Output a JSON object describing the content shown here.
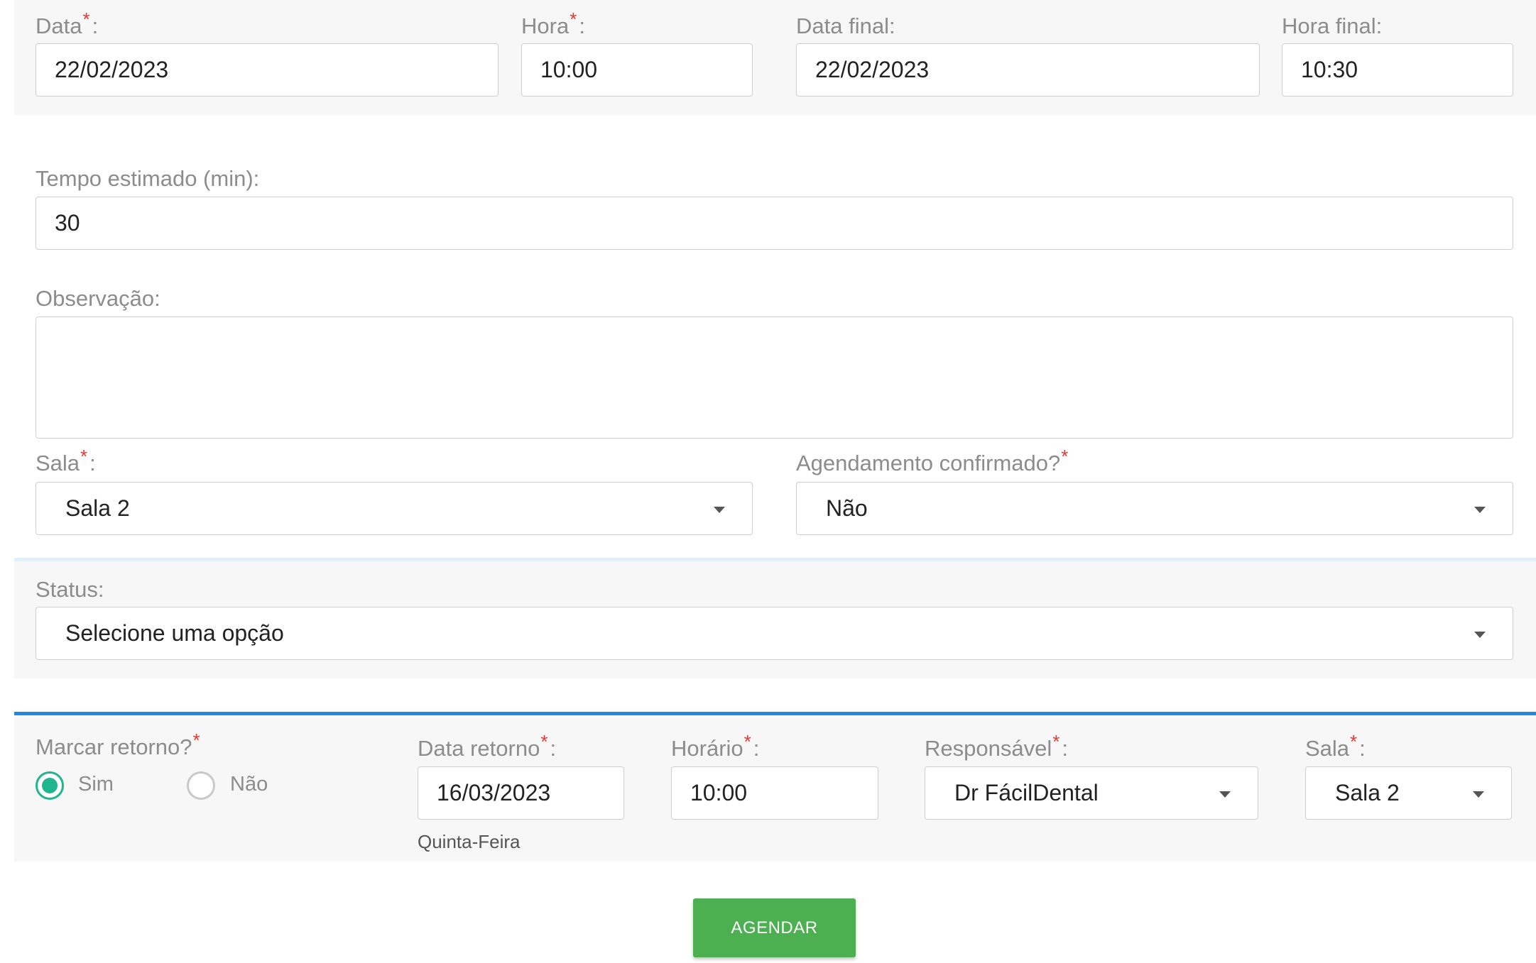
{
  "top": {
    "data": {
      "label": "Data",
      "value": "22/02/2023"
    },
    "hora": {
      "label": "Hora",
      "value": "10:00"
    },
    "data_final": {
      "label": "Data final:",
      "value": "22/02/2023"
    },
    "hora_final": {
      "label": "Hora final:",
      "value": "10:30"
    }
  },
  "tempo": {
    "label": "Tempo estimado (min):",
    "value": "30"
  },
  "observacao": {
    "label": "Observação:",
    "value": ""
  },
  "sala": {
    "label": "Sala",
    "value": "Sala 2"
  },
  "confirmado": {
    "label": "Agendamento confirmado?",
    "value": "Não"
  },
  "status": {
    "label": "Status:",
    "value": "Selecione uma opção"
  },
  "retorno": {
    "label": "Marcar retorno?",
    "options": [
      {
        "label": "Sim",
        "checked": true
      },
      {
        "label": "Não",
        "checked": false
      }
    ],
    "data_label": "Data retorno",
    "data_value": "16/03/2023",
    "weekday": "Quinta-Feira",
    "horario_label": "Horário",
    "horario_value": "10:00",
    "responsavel_label": "Responsável",
    "responsavel_value": "Dr FácilDental",
    "sala_label": "Sala",
    "sala_value": "Sala 2"
  },
  "required_mark": "*",
  "colon": ":",
  "submit_label": "AGENDAR",
  "colors": {
    "accent_blue": "#1e88e5",
    "radio_green": "#1fb58f",
    "button_green": "#4caf50",
    "required_red": "#e53935"
  }
}
